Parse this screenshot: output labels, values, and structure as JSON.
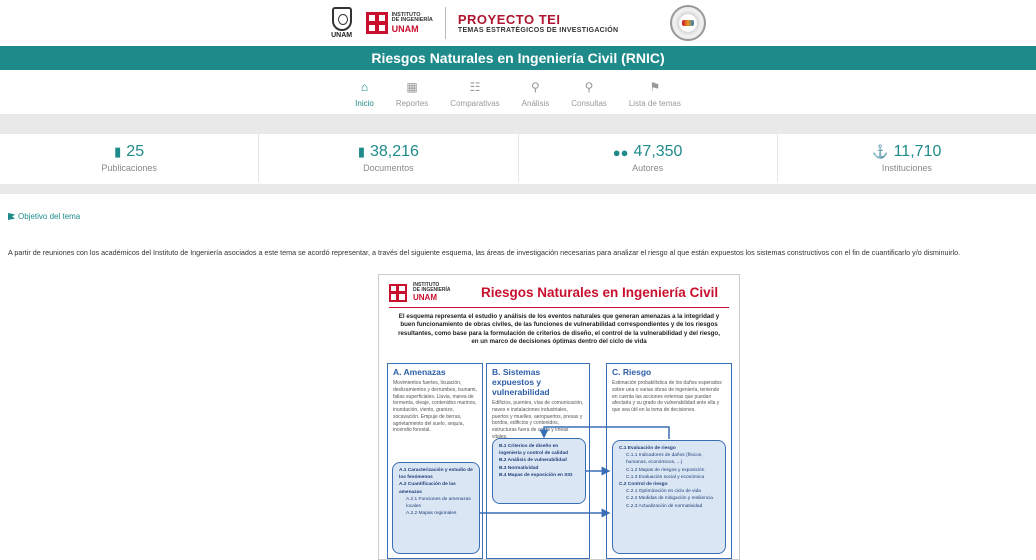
{
  "header": {
    "unam_seal_text": "UNAM",
    "ii_logo": {
      "line1": "INSTITUTO",
      "line2": "DE INGENIERÍA",
      "line3": "UNAM"
    },
    "project_title": "PROYECTO TEI",
    "project_subtitle": "TEMAS ESTRATÉGICOS DE INVESTIGACIÓN"
  },
  "page_title": "Riesgos Naturales en Ingeniería Civil (RNIC)",
  "nav": [
    {
      "label": "Inicio",
      "icon": "home-icon",
      "active": true
    },
    {
      "label": "Reportes",
      "icon": "table-icon"
    },
    {
      "label": "Comparativas",
      "icon": "network-icon"
    },
    {
      "label": "Análisis",
      "icon": "lightbulb-icon"
    },
    {
      "label": "Consultas",
      "icon": "search-icon"
    },
    {
      "label": "Lista de temas",
      "icon": "flag-icon"
    }
  ],
  "stats": [
    {
      "value": "25",
      "label": "Publicaciones",
      "icon": "book-icon"
    },
    {
      "value": "38,216",
      "label": "Documentos",
      "icon": "document-icon"
    },
    {
      "value": "47,350",
      "label": "Autores",
      "icon": "users-icon"
    },
    {
      "value": "11,710",
      "label": "Instituciones",
      "icon": "institution-icon"
    }
  ],
  "objetivo_label": "Objetivo del tema",
  "description": "A partir de reuniones con los académicos del Instituto de Ingeniería asociados a este tema se acordó representar, a través del siguiente esquema, las áreas de investigación necesarias para analizar el riesgo al que están expuestos los sistemas constructivos con el fin de cuantificarlo y/o disminuirlo.",
  "diagram": {
    "title": "Riesgos Naturales en Ingeniería Civil",
    "intro": "El esquema representa el estudio y análisis de los eventos naturales que generan amenazas a la integridad y buen funcionamiento de obras civiles, de las funciones de vulnerabilidad correspondientes y de los riesgos resultantes, como base para la formulación de criterios de diseño, el control de la vulnerabilidad y del riesgo, en un marco de decisiones óptimas dentro del ciclo de vida",
    "col_a": {
      "title": "A. Amenazas",
      "text": "Movimientos fuertes, licuación, deslizamientos y derrumbes, tsunami, fallas superficiales. Lluvia, marea de tormenta, oleaje, contenidos marinos, inundación, viento, granizo, socavación. Empuje de tierras, agrietamiento del suelo, sequía, incendio forestal.",
      "items": [
        "A.1 Caracterización y estudio de los fenómenos",
        "A.2 Cuantificación de las amenazas",
        "A.2.1 Funciones de amenazas locales",
        "A.2.2 Mapas regionales"
      ]
    },
    "col_b": {
      "title": "B. Sistemas expuestos y vulnerabilidad",
      "text": "Edificios, puentes, vías de comunicación, naves e instalaciones industriales, puertos y muelles, aeropuertos, presas y bordos, edificios y contenidos, estructuras fuera de costa y líneas vitales.",
      "items": [
        "B.1 Criterios de diseño en ingeniería y control de calidad",
        "B.2 Análisis de vulnerabilidad",
        "B.3 Normatividad",
        "B.4 Mapas de exposición en SIG"
      ]
    },
    "col_c": {
      "title": "C. Riesgo",
      "text": "Estimación probabilística de los daños esperados sobre una o varias obras de ingeniería, teniendo en cuenta las acciones externas que puedan afectarla y su grado de vulnerabilidad ante ella y que sea útil en la toma de decisiones.",
      "items": [
        "C.1 Evaluación de riesgo",
        "C.1.1 Indicadores de daños (físicos, humanos, económicos, ...)",
        "C.1.2 Mapas de riesgos y exposición",
        "C.1.3 Evaluación social y económica",
        "C.2 Control de riesgo",
        "C.2.1 Optimización en ciclo de vida",
        "C.2.2 Medidas de mitigación y resiliencia",
        "C.2.3 Actualización de normatividad"
      ]
    }
  }
}
